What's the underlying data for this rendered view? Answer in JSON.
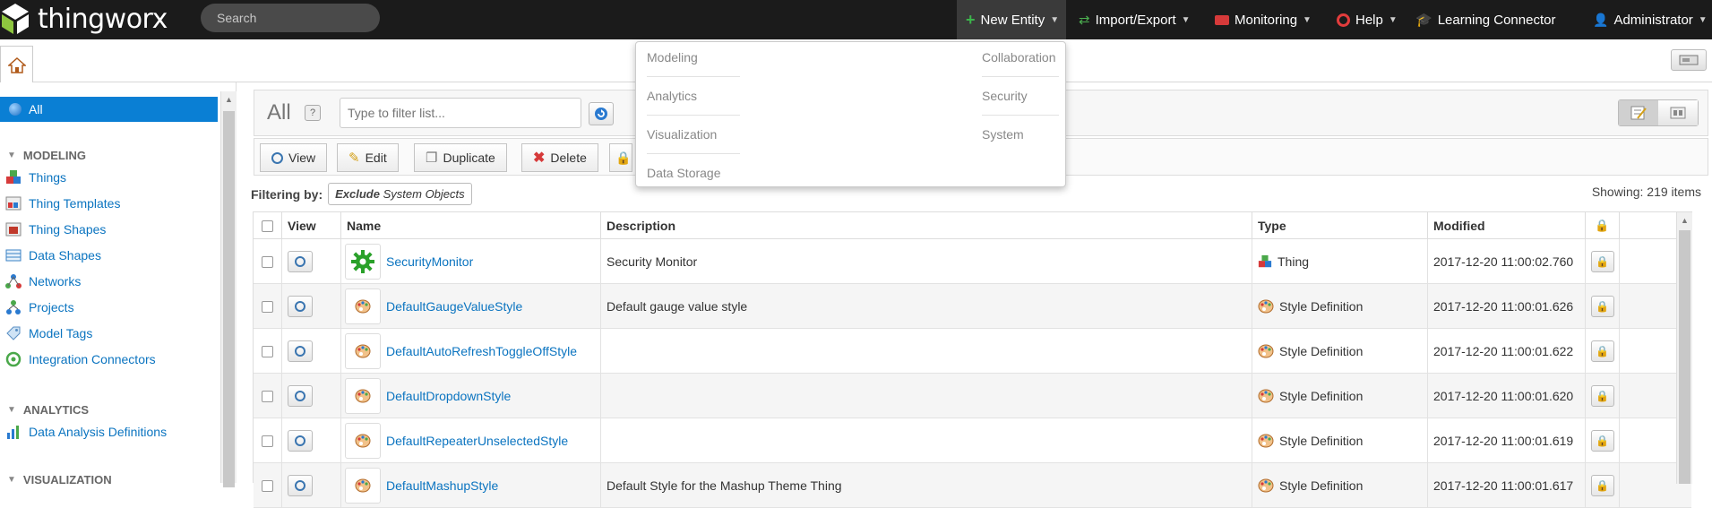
{
  "app": {
    "logo_text": "thingworx"
  },
  "search": {
    "placeholder": "Search"
  },
  "topnav": {
    "new_entity": "New Entity",
    "import_export": "Import/Export",
    "monitoring": "Monitoring",
    "help": "Help",
    "learning_connector": "Learning Connector",
    "user": "Administrator"
  },
  "dropdown": {
    "left": [
      "Modeling",
      "Analytics",
      "Visualization",
      "Data Storage"
    ],
    "right": [
      "Collaboration",
      "Security",
      "System"
    ]
  },
  "sidebar": {
    "all_label": "All",
    "sections": [
      {
        "title": "MODELING",
        "items": [
          "Things",
          "Thing Templates",
          "Thing Shapes",
          "Data Shapes",
          "Networks",
          "Projects",
          "Model Tags",
          "Integration Connectors"
        ]
      },
      {
        "title": "ANALYTICS",
        "items": [
          "Data Analysis Definitions"
        ]
      },
      {
        "title": "VISUALIZATION",
        "items": []
      }
    ]
  },
  "list": {
    "title": "All",
    "help": "?",
    "filter_placeholder": "Type to filter list...",
    "buttons": {
      "view": "View",
      "edit": "Edit",
      "duplicate": "Duplicate",
      "delete": "Delete"
    },
    "filtering_label": "Filtering by:",
    "filter_chip_bold": "Exclude",
    "filter_chip_rest": "System Objects",
    "showing": "Showing: 219 items"
  },
  "table": {
    "columns": {
      "view": "View",
      "name": "Name",
      "description": "Description",
      "type": "Type",
      "modified": "Modified"
    },
    "rows": [
      {
        "name": "SecurityMonitor",
        "description": "Security Monitor",
        "type": "Thing",
        "modified": "2017-12-20 11:00:02.760",
        "icon": "gear-icon"
      },
      {
        "name": "DefaultGaugeValueStyle",
        "description": "Default gauge value style",
        "type": "Style Definition",
        "modified": "2017-12-20 11:00:01.626",
        "icon": "palette-icon"
      },
      {
        "name": "DefaultAutoRefreshToggleOffStyle",
        "description": "",
        "type": "Style Definition",
        "modified": "2017-12-20 11:00:01.622",
        "icon": "palette-icon"
      },
      {
        "name": "DefaultDropdownStyle",
        "description": "",
        "type": "Style Definition",
        "modified": "2017-12-20 11:00:01.620",
        "icon": "palette-icon"
      },
      {
        "name": "DefaultRepeaterUnselectedStyle",
        "description": "",
        "type": "Style Definition",
        "modified": "2017-12-20 11:00:01.619",
        "icon": "palette-icon"
      },
      {
        "name": "DefaultMashupStyle",
        "description": "Default Style for the Mashup Theme Thing",
        "type": "Style Definition",
        "modified": "2017-12-20 11:00:01.617",
        "icon": "palette-icon"
      }
    ]
  },
  "colors": {
    "accent": "#0a7fd4",
    "topbar": "#1b1b1b",
    "link": "#0b74c0"
  }
}
